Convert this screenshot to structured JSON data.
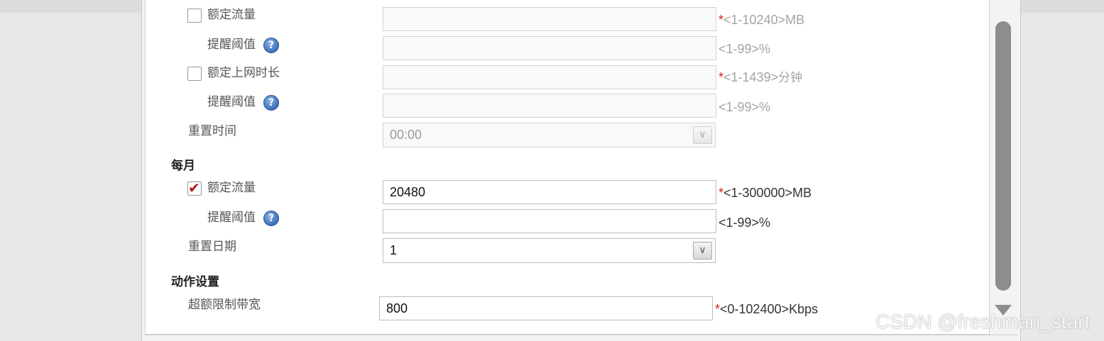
{
  "daily": {
    "quota_traffic": {
      "label": "额定流量",
      "checked": false,
      "value": "",
      "required_mark": "*",
      "hint": "<1-10240>MB"
    },
    "traffic_alert": {
      "label": "提醒阈值",
      "help_glyph": "?",
      "value": "",
      "hint": "<1-99>%"
    },
    "quota_time": {
      "label": "额定上网时长",
      "checked": false,
      "value": "",
      "required_mark": "*",
      "hint_range": "<1-1439>",
      "hint_unit": "分钟"
    },
    "time_alert": {
      "label": "提醒阈值",
      "help_glyph": "?",
      "value": "",
      "hint": "<1-99>%"
    },
    "reset_time": {
      "label": "重置时间",
      "selected": "00:00"
    }
  },
  "monthly": {
    "section_title": "每月",
    "quota_traffic": {
      "label": "额定流量",
      "checked": true,
      "value": "20480",
      "required_mark": "*",
      "hint": "<1-300000>MB"
    },
    "traffic_alert": {
      "label": "提醒阈值",
      "help_glyph": "?",
      "value": "",
      "hint": "<1-99>%"
    },
    "reset_date": {
      "label": "重置日期",
      "selected": "1"
    }
  },
  "action": {
    "section_title": "动作设置",
    "over_limit_bandwidth": {
      "label": "超额限制带宽",
      "value": "800",
      "required_mark": "*",
      "hint": "<0-102400>Kbps"
    }
  },
  "watermark": "CSDN @freshman_start",
  "colors": {
    "required_star": "#d62020",
    "checkmark": "#b01818",
    "scrollbar": "#8d8d8d",
    "help_icon": "#3a6fb8"
  }
}
